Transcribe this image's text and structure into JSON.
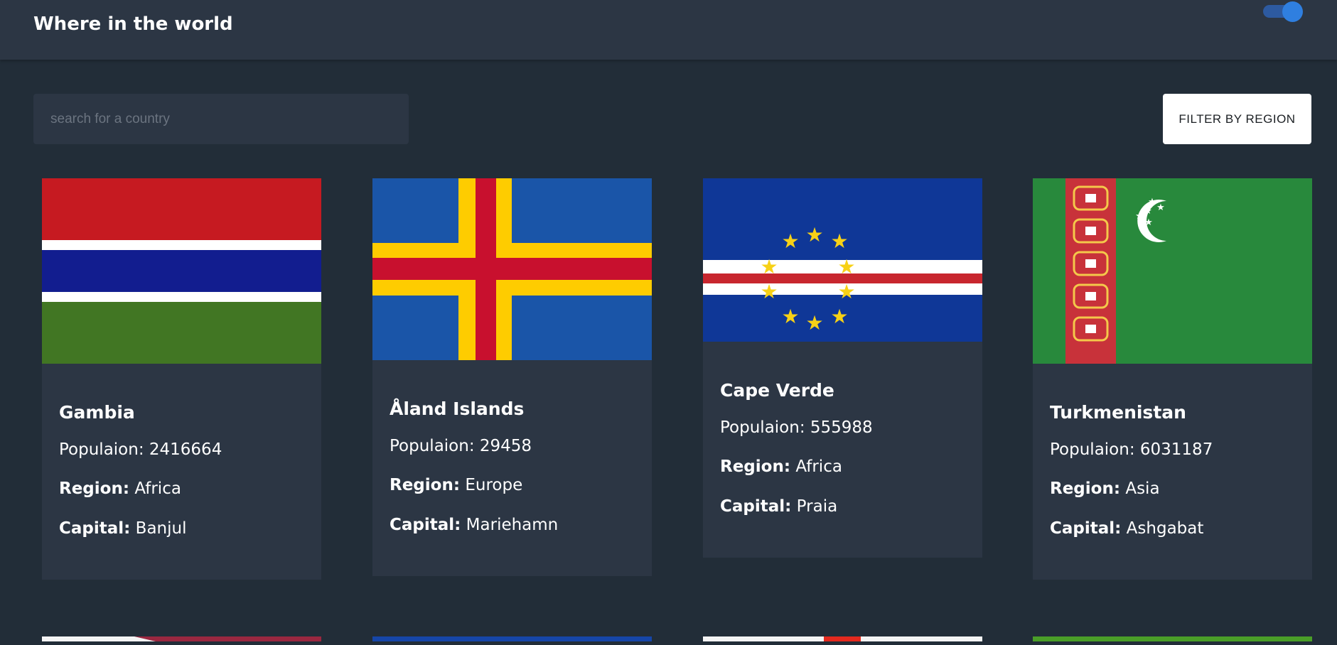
{
  "header": {
    "title": "Where in the world"
  },
  "search": {
    "placeholder": "search for a country"
  },
  "filter": {
    "label": "FILTER BY REGION"
  },
  "labels": {
    "population": "Populaion:",
    "region": "Region:",
    "capital": "Capital:"
  },
  "countries": [
    {
      "name": "Gambia",
      "population": "2416664",
      "region": "Africa",
      "capital": "Banjul"
    },
    {
      "name": "Åland Islands",
      "population": "29458",
      "region": "Europe",
      "capital": "Mariehamn"
    },
    {
      "name": "Cape Verde",
      "population": "555988",
      "region": "Africa",
      "capital": "Praia"
    },
    {
      "name": "Turkmenistan",
      "population": "6031187",
      "region": "Asia",
      "capital": "Ashgabat"
    }
  ],
  "colors": {
    "background": "#222d38",
    "surface": "#2c3644",
    "toggle_accent": "#2f7fe0"
  }
}
